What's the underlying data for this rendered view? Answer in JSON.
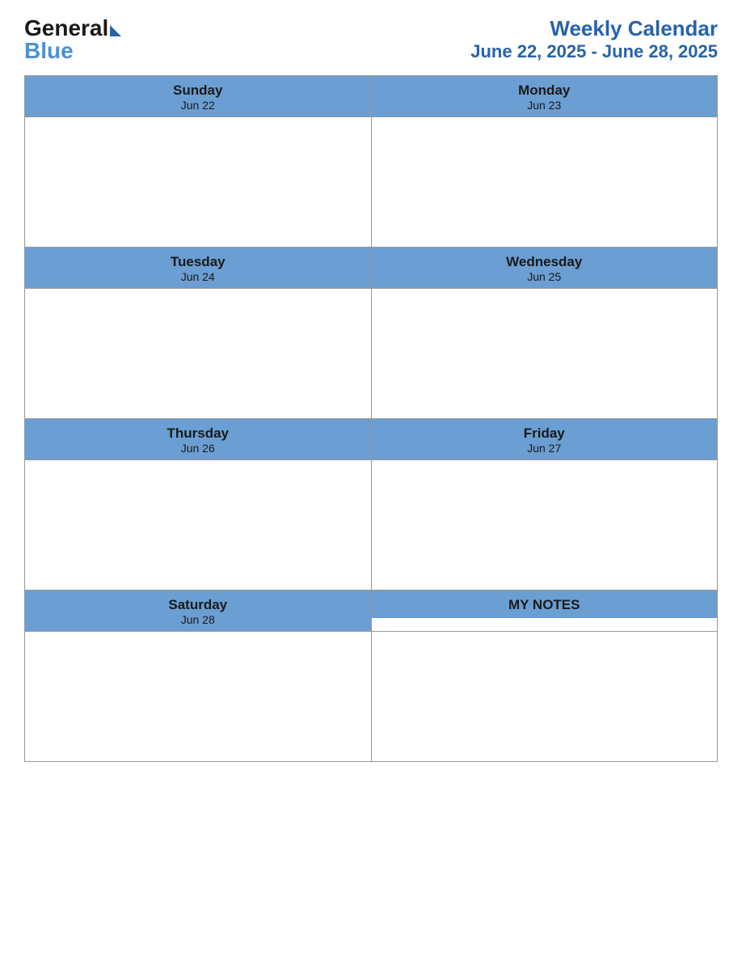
{
  "logo": {
    "general": "General",
    "blue": "Blue"
  },
  "header": {
    "title": "Weekly Calendar",
    "subtitle": "June 22, 2025 - June 28, 2025"
  },
  "days": [
    {
      "name": "Sunday",
      "date": "Jun 22"
    },
    {
      "name": "Monday",
      "date": "Jun 23"
    },
    {
      "name": "Tuesday",
      "date": "Jun 24"
    },
    {
      "name": "Wednesday",
      "date": "Jun 25"
    },
    {
      "name": "Thursday",
      "date": "Jun 26"
    },
    {
      "name": "Friday",
      "date": "Jun 27"
    },
    {
      "name": "Saturday",
      "date": "Jun 28"
    }
  ],
  "notes": {
    "label": "MY NOTES"
  }
}
